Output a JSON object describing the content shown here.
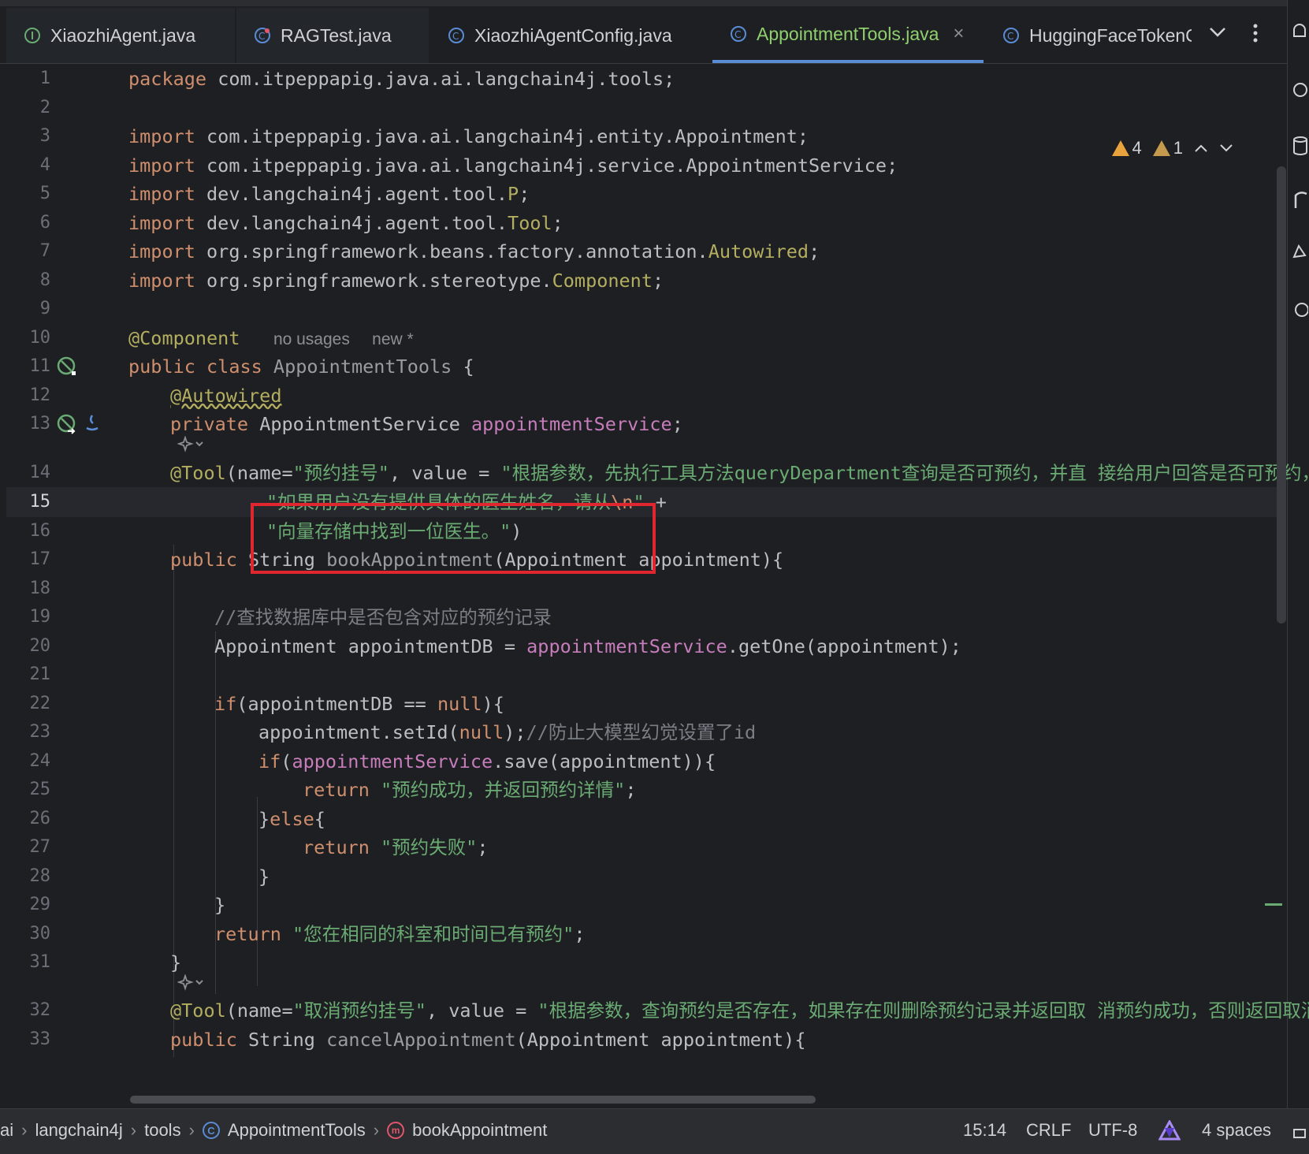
{
  "tabs": [
    {
      "label": "XiaozhiAgent.java",
      "icon": "interface-icon",
      "state": "dim"
    },
    {
      "label": "RAGTest.java",
      "icon": "test-class-icon",
      "state": "dim"
    },
    {
      "label": "XiaozhiAgentConfig.java",
      "icon": "class-icon",
      "state": "normal"
    },
    {
      "label": "AppointmentTools.java",
      "icon": "class-icon",
      "state": "active"
    },
    {
      "label": "HuggingFaceTokenC",
      "icon": "class-icon",
      "state": "normal"
    }
  ],
  "tab_close": "×",
  "inspections": {
    "warnings": "4",
    "weak_warnings": "1"
  },
  "code": {
    "l1": {
      "num": "1",
      "kw": "package",
      "rest": " com.itpeppapig.java.ai.langchain4j.tools;"
    },
    "l2": {
      "num": "2"
    },
    "l3": {
      "num": "3",
      "kw": "import",
      "rest": " com.itpeppapig.java.ai.langchain4j.entity.Appointment;"
    },
    "l4": {
      "num": "4",
      "kw": "import",
      "rest": " com.itpeppapig.java.ai.langchain4j.service.AppointmentService;"
    },
    "l5": {
      "num": "5",
      "kw": "import",
      "rest": " dev.langchain4j.agent.tool.",
      "cls": "P",
      "end": ";"
    },
    "l6": {
      "num": "6",
      "kw": "import",
      "rest": " dev.langchain4j.agent.tool.",
      "cls": "Tool",
      "end": ";"
    },
    "l7": {
      "num": "7",
      "kw": "import",
      "rest": " org.springframework.beans.factory.annotation.",
      "cls": "Autowired",
      "end": ";"
    },
    "l8": {
      "num": "8",
      "kw": "import",
      "rest": " org.springframework.stereotype.",
      "cls": "Component",
      "end": ";"
    },
    "l9": {
      "num": "9"
    },
    "l10": {
      "num": "10",
      "ann": "@Component",
      "hint1": "no usages",
      "hint2": "new *"
    },
    "l11": {
      "num": "11",
      "kw": "public class",
      "name": " AppointmentTools",
      "rest": " {"
    },
    "l12": {
      "num": "12",
      "ann": "@Autowired"
    },
    "l13": {
      "num": "13",
      "kw": "private",
      "type": " AppointmentService ",
      "fld": "appointmentService",
      "end": ";"
    },
    "l14": {
      "num": "14",
      "ann": "@Tool",
      "p1": "(name=",
      "s1": "\"预约挂号\"",
      "p2": ", value = ",
      "s2": "\"根据参数，先执行工具方法",
      "s3": "queryDepartment",
      "s4": "查询是否可预约，并直 接给用户回答是否可预约，并"
    },
    "l15": {
      "num": "15",
      "s1": "\"如果用户没有提供具体的医生姓名，请从",
      "esc": "\\n",
      "s2": "\"",
      "op": " +"
    },
    "l16": {
      "num": "16",
      "s1": "\"向量存储中找到一位医生。\"",
      "end": ")"
    },
    "l17": {
      "num": "17",
      "kw": "public",
      "type": " String ",
      "fn": "bookAppointment",
      "rest": "(Appointment appointment){"
    },
    "l18": {
      "num": "18"
    },
    "l19": {
      "num": "19",
      "cmt": "//查找数据库中是否包含对应的预约记录"
    },
    "l20": {
      "num": "20",
      "p1": "Appointment appointmentDB = ",
      "fld": "appointmentService",
      "p2": ".getOne(appointment);"
    },
    "l21": {
      "num": "21"
    },
    "l22": {
      "num": "22",
      "kw": "if",
      "p1": "(appointmentDB == ",
      "kw2": "null",
      "p2": "){"
    },
    "l23": {
      "num": "23",
      "p1": "appointment.setId(",
      "kw": "null",
      "p2": ");",
      "cmt": "//防止大模型幻觉设置了id"
    },
    "l24": {
      "num": "24",
      "kw": "if",
      "p1": "(",
      "fld": "appointmentService",
      "p2": ".save(appointment)){"
    },
    "l25": {
      "num": "25",
      "kw": "return",
      "s": " \"预约成功，并返回预约详情\"",
      "end": ";"
    },
    "l26": {
      "num": "26",
      "p1": "}",
      "kw": "else",
      "p2": "{"
    },
    "l27": {
      "num": "27",
      "kw": "return",
      "s": " \"预约失败\"",
      "end": ";"
    },
    "l28": {
      "num": "28",
      "p1": "}"
    },
    "l29": {
      "num": "29",
      "p1": "}"
    },
    "l30": {
      "num": "30",
      "kw": "return",
      "s": " \"您在相同的科室和时间已有预约\"",
      "end": ";"
    },
    "l31": {
      "num": "31",
      "p1": "}"
    },
    "l32": {
      "num": "32",
      "ann": "@Tool",
      "p1": "(name=",
      "s1": "\"取消预约挂号\"",
      "p2": ", value = ",
      "s2": "\"根据参数，查询预约是否存在，如果存在则删除预约记录并返回取 消预约成功，否则返回取消预"
    },
    "l33": {
      "num": "33",
      "kw": "public",
      "type": " String ",
      "fn": "cancelAppointment",
      "rest": "(Appointment appointment){"
    }
  },
  "breadcrumb": [
    "ai",
    "langchain4j",
    "tools",
    "AppointmentTools",
    "bookAppointment"
  ],
  "status": {
    "position": "15:14",
    "line_sep": "CRLF",
    "encoding": "UTF-8",
    "indent": "4 spaces"
  }
}
